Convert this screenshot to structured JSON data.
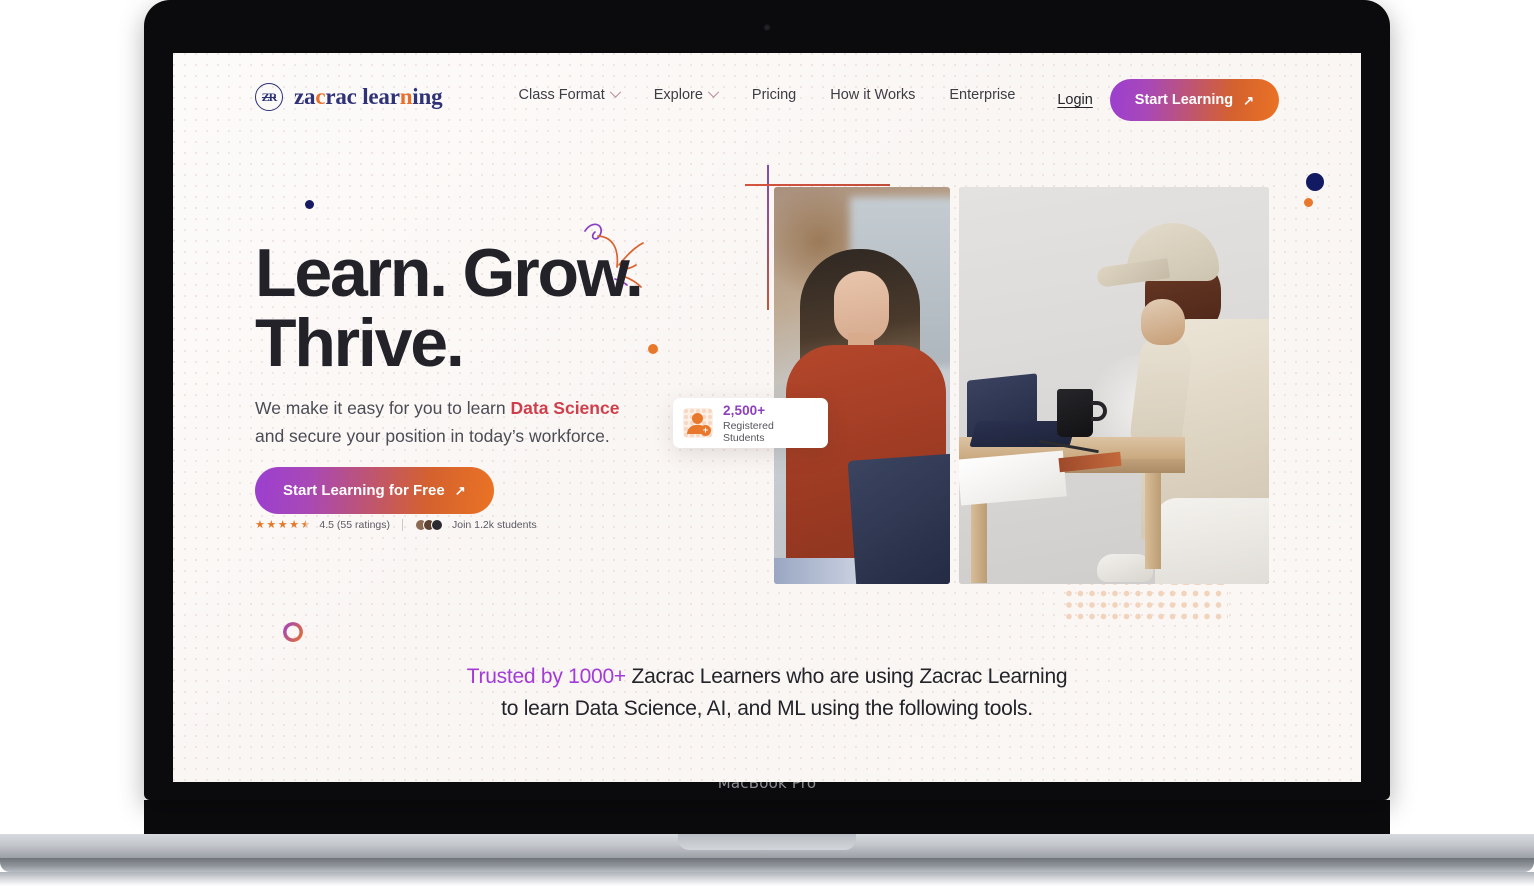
{
  "device": {
    "label": "MacBook Pro"
  },
  "brand": {
    "name_part1": "za",
    "name_hl1": "c",
    "name_part2": "rac lear",
    "name_hl2": "n",
    "name_part3": "ing",
    "mark_text": "ZR"
  },
  "nav": {
    "links": [
      {
        "label": "Class Format",
        "has_chevron": true
      },
      {
        "label": "Explore",
        "has_chevron": true
      },
      {
        "label": "Pricing",
        "has_chevron": false
      },
      {
        "label": "How it Works",
        "has_chevron": false
      },
      {
        "label": "Enterprise",
        "has_chevron": false
      }
    ],
    "login_label": "Login",
    "cta_label": "Start Learning",
    "cta_arrow": "↗"
  },
  "hero": {
    "title_line1": "Learn. Grow.",
    "title_line2": "Thrive.",
    "sub_pre": "We make it easy for you to learn ",
    "sub_hl": "Data Science",
    "sub_post": " and secure your position in today’s workforce.",
    "cta_label": "Start Learning for Free",
    "cta_arrow": "↗",
    "rating_value": "4.5 (55 ratings)",
    "students_label": "Join 1.2k students",
    "stars": [
      "full",
      "full",
      "full",
      "full",
      "half"
    ]
  },
  "stat_card": {
    "number": "2,500+",
    "label": "Registered Students",
    "icon": "add-user-icon"
  },
  "trusted": {
    "hl": "Trusted by 1000+",
    "rest": " Zacrac Learners who are using Zacrac Learning",
    "line2": "to learn Data Science, AI, and ML using the following tools."
  },
  "photos": [
    {
      "alt": "woman-studying-on-laptop"
    },
    {
      "alt": "man-working-at-desk"
    }
  ],
  "colors": {
    "brand_navy": "#2f3277",
    "brand_orange": "#e8702c",
    "accent_purple": "#a23bd8",
    "accent_red": "#cf3f4b",
    "gradient_start": "#9b3fd0",
    "gradient_end": "#ea7324",
    "stat_purple": "#8d3fbd",
    "page_bg": "#fbf8f6"
  }
}
